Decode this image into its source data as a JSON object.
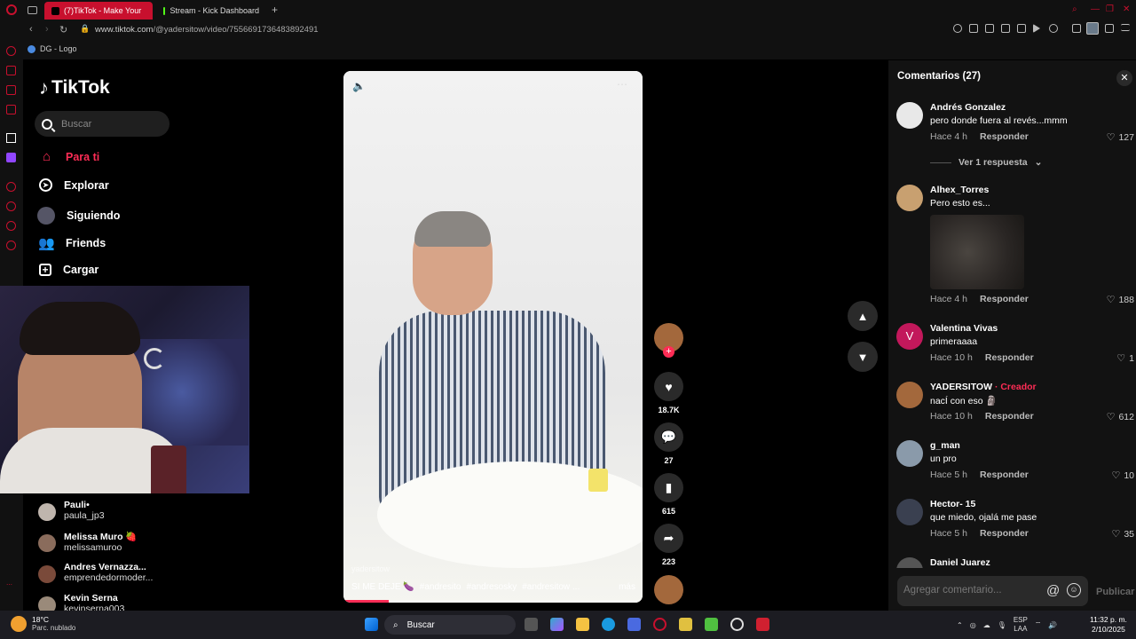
{
  "browser": {
    "tabs": [
      {
        "label": "(7)TikTok - Make Your",
        "active": true
      },
      {
        "label": "Stream - Kick Dashboard",
        "active": false
      }
    ],
    "url_prefix": "www.tiktok.com",
    "url_path": "/@yadersitow/video/7556691736483892491",
    "bookmark": "DG - Logo"
  },
  "tiktok": {
    "logo": "TikTok",
    "search_placeholder": "Buscar",
    "nav": [
      {
        "label": "Para ti",
        "icon": "home-icon",
        "active": true
      },
      {
        "label": "Explorar",
        "icon": "compass-icon",
        "active": false
      },
      {
        "label": "Siguiendo",
        "icon": "following-avatar-icon",
        "active": false
      },
      {
        "label": "Friends",
        "icon": "friends-icon",
        "active": false
      },
      {
        "label": "Cargar",
        "icon": "upload-icon",
        "active": false
      }
    ],
    "following": [
      {
        "name": "Pauli•",
        "handle": "paula_jp3"
      },
      {
        "name": "Melissa Muro 🍓",
        "handle": "melissamuroo"
      },
      {
        "name": "Andres Vernazza...",
        "handle": "emprendedormoder..."
      },
      {
        "name": "Kevin Serna",
        "handle": "kevinserna003"
      }
    ]
  },
  "video": {
    "watermark": "yadersitow",
    "caption_text": "SI ME DEJE 🍆",
    "hashtags": [
      "#andresito",
      "#andresosky",
      "#andresitow ..."
    ],
    "more": "más",
    "progress": 0.15
  },
  "actions": {
    "likes": "18.7K",
    "comments": "27",
    "saves": "615",
    "shares": "223"
  },
  "comments_panel": {
    "title": "Comentarios (27)",
    "view_replies": "Ver 1 respuesta",
    "reply_label": "Responder",
    "creator_tag": "· Creador",
    "input_placeholder": "Agregar comentario...",
    "publish": "Publicar",
    "items": [
      {
        "user": "Andrés Gonzalez",
        "text": "pero donde fuera al revés...mmm",
        "time": "Hace 4 h",
        "likes": "127"
      },
      {
        "user": "Alhex_Torres",
        "text": "Pero esto es...",
        "time": "Hace 4 h",
        "likes": "188"
      },
      {
        "user": "Valentina Vivas",
        "text": "primeraaaa",
        "time": "Hace 10 h",
        "likes": "1",
        "initial": "V"
      },
      {
        "user": "YADERSITOW",
        "text": "nacÍ con eso 🗿",
        "time": "Hace 10 h",
        "likes": "612"
      },
      {
        "user": "g_man",
        "text": "un pro",
        "time": "Hace 5 h",
        "likes": "10"
      },
      {
        "user": "Hector- 15",
        "text": "que miedo, ojalá me pase",
        "time": "Hace 5 h",
        "likes": "35"
      },
      {
        "user": "Daniel Juarez"
      }
    ]
  },
  "taskbar": {
    "temp": "18°C",
    "weather": "Parc. nublado",
    "search": "Buscar",
    "lang1": "ESP",
    "lang2": "LAA",
    "time": "11:32 p. m.",
    "date": "2/10/2025"
  },
  "colors": {
    "accent": "#fe2c55",
    "opera": "#c8102e",
    "panel": "#121212"
  }
}
